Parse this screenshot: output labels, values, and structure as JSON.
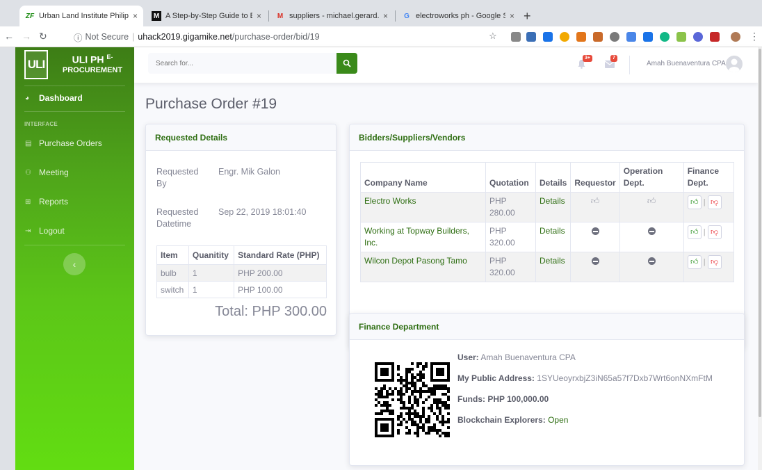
{
  "browser": {
    "tabs": [
      {
        "title": "Urban Land Institute Philippine",
        "favicon": "ZF",
        "active": true
      },
      {
        "title": "A Step-by-Step Guide to Buildi",
        "favicon": "M",
        "active": false
      },
      {
        "title": "suppliers - michael.gerard.galo",
        "favicon": "M",
        "active": false
      },
      {
        "title": "electroworks ph - Google Sear",
        "favicon": "G",
        "active": false
      }
    ],
    "close_glyph": "×",
    "new_tab_glyph": "+",
    "security": "Not Secure",
    "url_host": "uhack2019.gigamike.net",
    "url_path": "/purchase-order/bid/19"
  },
  "sidebar": {
    "brand_logo": "ULI",
    "brand_line1": "ULI PH",
    "brand_sup": "E-",
    "brand_line2": "PROCUREMENT",
    "dashboard": "Dashboard",
    "section_heading": "INTERFACE",
    "items": [
      {
        "label": "Purchase Orders",
        "icon": "file-icon"
      },
      {
        "label": "Meeting",
        "icon": "users-icon"
      },
      {
        "label": "Reports",
        "icon": "table-icon"
      },
      {
        "label": "Logout",
        "icon": "sign-out-icon"
      }
    ],
    "toggle_glyph": "‹"
  },
  "topbar": {
    "search_placeholder": "Search for...",
    "alerts_badge": "3+",
    "messages_badge": "7",
    "user_name": "Amah Buenaventura CPA"
  },
  "page": {
    "title": "Purchase Order #19"
  },
  "requested": {
    "header": "Requested Details",
    "by_label": "Requested By",
    "by_value": "Engr. Mik Galon",
    "datetime_label": "Requested Datetime",
    "datetime_value": "Sep 22, 2019 18:01:40",
    "columns": [
      "Item",
      "Quanitity",
      "Standard Rate (PHP)"
    ],
    "rows": [
      [
        "bulb",
        "1",
        "PHP 200.00"
      ],
      [
        "switch",
        "1",
        "PHP 100.00"
      ]
    ],
    "total": "Total: PHP 300.00"
  },
  "bidders": {
    "header": "Bidders/Suppliers/Vendors",
    "columns": [
      "Company Name",
      "Quotation",
      "Details",
      "Requestor",
      "Operation Dept.",
      "Finance Dept."
    ],
    "rows": [
      {
        "company": "Electro Works",
        "quotation": "PHP 280.00",
        "details": "Details",
        "requestor": "approved",
        "operation": "approved"
      },
      {
        "company": "Working at Topway Builders, Inc.",
        "quotation": "PHP 320.00",
        "details": "Details",
        "requestor": "pending",
        "operation": "pending"
      },
      {
        "company": "Wilcon Depot Pasong Tamo",
        "quotation": "PHP 320.00",
        "details": "Details",
        "requestor": "pending",
        "operation": "pending"
      }
    ],
    "vote_separator": "|"
  },
  "finance": {
    "header": "Finance Department",
    "user_label": "User:",
    "user_value": "Amah Buenaventura CPA",
    "address_label": "My Public Address:",
    "address_value": "1SYUeoyrxbjZ3iN65a57f7Dxb7Wrt6onNXmFtM",
    "funds_label": "Funds:",
    "funds_value": "PHP 100,000.00",
    "explorers_label": "Blockchain Explorers:",
    "explorers_link": "Open"
  },
  "colors": {
    "accent": "#3a8a1a",
    "link": "#2e6e12",
    "upvote": "#1a8a10",
    "downvote": "#e8141b"
  }
}
